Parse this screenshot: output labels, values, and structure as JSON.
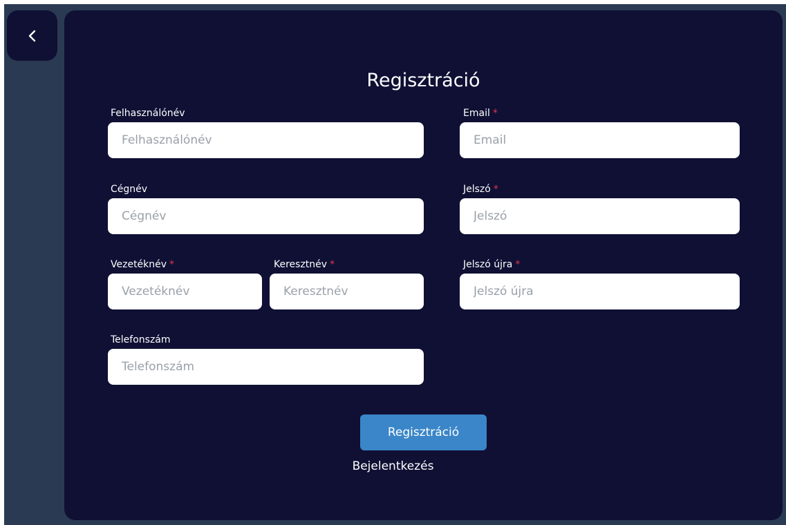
{
  "back_button": {
    "icon": "chevron-left-icon"
  },
  "form": {
    "title": "Regisztráció",
    "required_mark": "*",
    "fields": {
      "username": {
        "label": "Felhasználónév",
        "placeholder": "Felhasználónév",
        "value": ""
      },
      "company": {
        "label": "Cégnév",
        "placeholder": "Cégnév",
        "value": ""
      },
      "last_name": {
        "label": "Vezetéknév",
        "placeholder": "Vezetéknév",
        "value": ""
      },
      "first_name": {
        "label": "Keresztnév",
        "placeholder": "Keresztnév",
        "value": ""
      },
      "phone": {
        "label": "Telefonszám",
        "placeholder": "Telefonszám",
        "value": ""
      },
      "email": {
        "label": "Email",
        "placeholder": "Email",
        "value": ""
      },
      "password": {
        "label": "Jelszó",
        "placeholder": "Jelszó",
        "value": ""
      },
      "password_again": {
        "label": "Jelszó újra",
        "placeholder": "Jelszó újra",
        "value": ""
      }
    },
    "submit_label": "Regisztráció",
    "login_link": "Bejelentkezés"
  },
  "colors": {
    "background": "#2a3a52",
    "card": "#0f1034",
    "accent": "#3a86c8",
    "required": "#e0354a"
  }
}
